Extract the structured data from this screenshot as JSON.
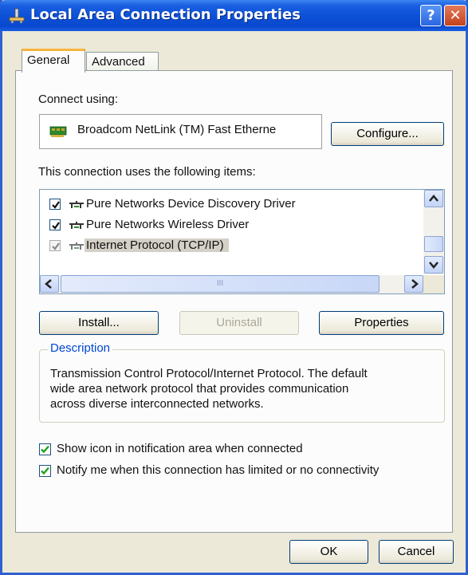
{
  "window": {
    "title": "Local Area Connection Properties",
    "help_label": "?",
    "close_label": "✕"
  },
  "tabs": [
    {
      "label": "General",
      "active": true
    },
    {
      "label": "Advanced",
      "active": false
    }
  ],
  "connect_using": {
    "label": "Connect using:",
    "adapter": "Broadcom NetLink (TM) Fast Etherne",
    "configure_label": "Configure..."
  },
  "items": {
    "label": "This connection uses the following items:",
    "list": [
      {
        "label": "Pure Networks Device Discovery Driver",
        "checked": true,
        "selected": false,
        "icon": "network-component-icon"
      },
      {
        "label": "Pure Networks Wireless Driver",
        "checked": true,
        "selected": false,
        "icon": "network-component-icon"
      },
      {
        "label": "Internet Protocol (TCP/IP)",
        "checked": true,
        "selected": true,
        "icon": "network-component-icon"
      }
    ],
    "hscroll_grip": "III"
  },
  "buttons": {
    "install": "Install...",
    "uninstall": "Uninstall",
    "properties": "Properties",
    "ok": "OK",
    "cancel": "Cancel"
  },
  "description": {
    "legend": "Description",
    "lines": [
      "Transmission Control Protocol/Internet Protocol. The default",
      "wide area network protocol that provides communication",
      "across diverse interconnected networks."
    ]
  },
  "options": [
    {
      "label": "Show icon in notification area when connected",
      "checked": true
    },
    {
      "label": "Notify me when this connection has limited or no connectivity",
      "checked": true
    }
  ],
  "colors": {
    "titlebar": "#0b4fd6",
    "dialog": "#ece9d8",
    "tab_highlight": "#f7b33c",
    "legend": "#0046d5",
    "checkmark": "#21a121"
  }
}
